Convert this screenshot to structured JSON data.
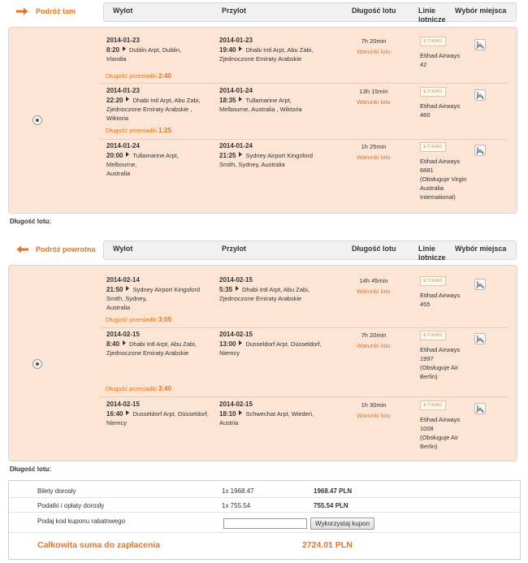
{
  "columns": {
    "departure": "Wylot",
    "arrival": "Przylot",
    "duration": "Długość lotu",
    "airlines": "Linie lotnicze",
    "seat": "Wybór miejsca"
  },
  "outbound": {
    "tab_label": "Podróż tam",
    "flight_length_label": "Długość lotu:",
    "selected": true,
    "segments": [
      {
        "dep_date": "2014-01-23",
        "dep_time": "8:20",
        "dep_place": "Dublin Arpt, Dublin,",
        "dep_place2": "Irlandia",
        "arr_date": "2014-01-23",
        "arr_time": "19:40",
        "arr_place": "Dhabi Intl Arpt, Abu Zabi,",
        "arr_place2": "Zjednoczone Emiraty Arabskie",
        "duration": "7h 20min",
        "conditions": "Warunki lotu",
        "logo": "ETIHAD",
        "airline": "Etihad Airways",
        "flight_no": "42",
        "operated": []
      },
      {
        "dep_date": "2014-01-23",
        "dep_time": "22:20",
        "dep_place": "Dhabi Intl Arpt, Abu Zabi,",
        "dep_place2": "Zjednoczone Emiraty Arabskie ,",
        "dep_place3": "Wiktoria",
        "arr_date": "2014-01-24",
        "arr_time": "18:35",
        "arr_place": "Tullamarine Arpt,",
        "arr_place2": "Melbourne, Australia , Wiktoria",
        "duration": "13h 15min",
        "conditions": "Warunki lotu",
        "logo": "ETIHAD",
        "airline": "Etihad Airways",
        "flight_no": "460",
        "operated": []
      },
      {
        "dep_date": "2014-01-24",
        "dep_time": "20:00",
        "dep_place": "Tullamarine Arpt,",
        "dep_place2": "Melbourne,",
        "dep_place3": "Australia",
        "arr_date": "2014-01-24",
        "arr_time": "21:25",
        "arr_place": "Sydney Airport Kingsford",
        "arr_place2": "Smith, Sydney, Australia",
        "duration": "1h 25min",
        "conditions": "Warunki lotu",
        "logo": "ETIHAD",
        "airline": "Etihad Airways",
        "flight_no": "6881",
        "operated": [
          "(Obsługuje Virgin",
          "Australia",
          "International)"
        ]
      }
    ],
    "layovers": [
      {
        "label": "Długość przesiadki",
        "value": "2:40"
      },
      {
        "label": "Długość przesiadki",
        "value": "1:25"
      }
    ]
  },
  "return": {
    "tab_label": "Podróż powrotna",
    "flight_length_label": "Długość lotu:",
    "selected": true,
    "segments": [
      {
        "dep_date": "2014-02-14",
        "dep_time": "21:50",
        "dep_place": "Sydney Airport Kingsford",
        "dep_place2": "Smith, Sydney,",
        "dep_place3": "Australia",
        "arr_date": "2014-02-15",
        "arr_time": "5:35",
        "arr_place": "Dhabi Intl Arpt, Abu Zabi,",
        "arr_place2": "Zjednoczone Emiraty Arabskie",
        "duration": "14h 45min",
        "conditions": "Warunki lotu",
        "logo": "ETIHAD",
        "airline": "Etihad Airways",
        "flight_no": "455",
        "operated": []
      },
      {
        "dep_date": "2014-02-15",
        "dep_time": "8:40",
        "dep_place": "Dhabi Intl Arpt, Abu Zabi,",
        "dep_place2": "Zjednoczone Emiraty Arabskie",
        "arr_date": "2014-02-15",
        "arr_time": "13:00",
        "arr_place": "Dusseldorf Arpt, Düsseldorf,",
        "arr_place2": "Niemcy",
        "duration": "7h 20min",
        "conditions": "Warunki lotu",
        "logo": "ETIHAD",
        "airline": "Etihad Airways",
        "flight_no": "1997",
        "operated": [
          "(Obsługuje Air",
          "Berlin)"
        ]
      },
      {
        "dep_date": "2014-02-15",
        "dep_time": "16:40",
        "dep_place": "Dusseldorf Arpt, Düsseldorf,",
        "dep_place2": "Niemcy",
        "arr_date": "2014-02-15",
        "arr_time": "18:10",
        "arr_place": "Schwechat Arpt, Wiedeń,",
        "arr_place2": "Austria",
        "duration": "1h 30min",
        "conditions": "Warunki lotu",
        "logo": "ETIHAD",
        "airline": "Etihad Airways",
        "flight_no": "1008",
        "operated": [
          "(Obsługuje Air",
          "Berlin)"
        ]
      }
    ],
    "layovers": [
      {
        "label": "Długość przesiadki",
        "value": "3:05"
      },
      {
        "label": "Długość przesiadki",
        "value": "3:40"
      }
    ]
  },
  "summary": {
    "adult_tickets_label": "Bilety dorosły",
    "adult_tickets_qty": "1x 1968.47",
    "adult_tickets_amount": "1968.47 PLN",
    "taxes_label": "Podatki i opłaty dorosły",
    "taxes_qty": "1x 755.54",
    "taxes_amount": "755.54 PLN",
    "coupon_label": "Podaj kod kuponu rabatowego",
    "coupon_value": "",
    "coupon_button": "Wykorzystaj kupon",
    "total_label": "Całkowita suma do zapłacenia",
    "total_amount": "2724.01 PLN"
  },
  "colors": {
    "accent": "#e8731c",
    "panel": "#fde5d6",
    "header": "#f1f1f1"
  }
}
